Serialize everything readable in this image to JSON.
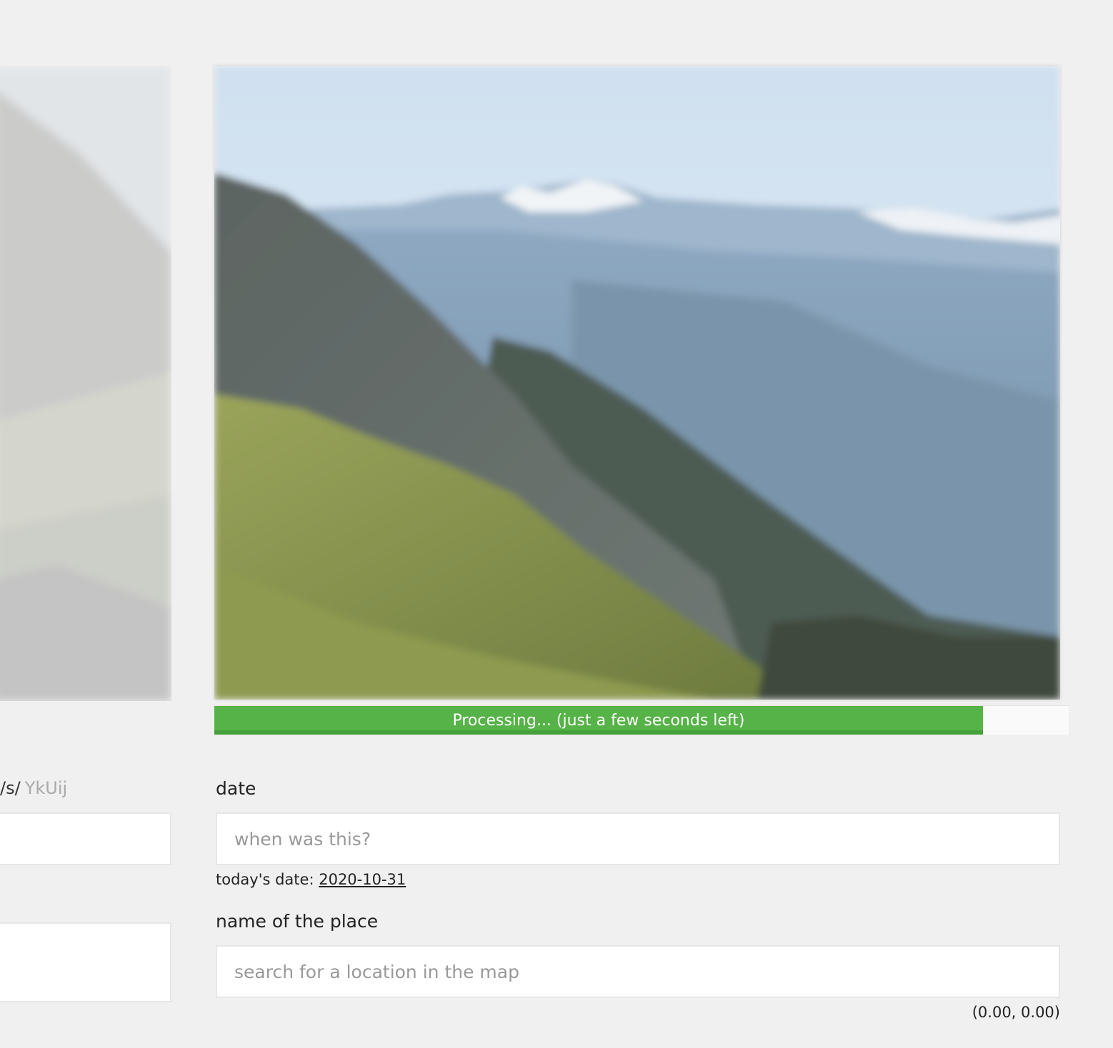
{
  "progress": {
    "label": "Processing... (just a few seconds left)",
    "fraction": 0.9
  },
  "left_column": {
    "url_prefix": "/s/",
    "url_slug": "YkUij"
  },
  "form": {
    "date": {
      "label": "date",
      "placeholder": "when was this?",
      "hint_prefix": "today's date:",
      "today": "2020-10-31"
    },
    "place": {
      "label": "name of the place",
      "placeholder": "search for a location in the map",
      "coordinates": "(0.00, 0.00)"
    }
  },
  "colors": {
    "progress_fill": "#56b347",
    "progress_fill_dark": "#45a03a",
    "background": "#f0f0f0"
  }
}
